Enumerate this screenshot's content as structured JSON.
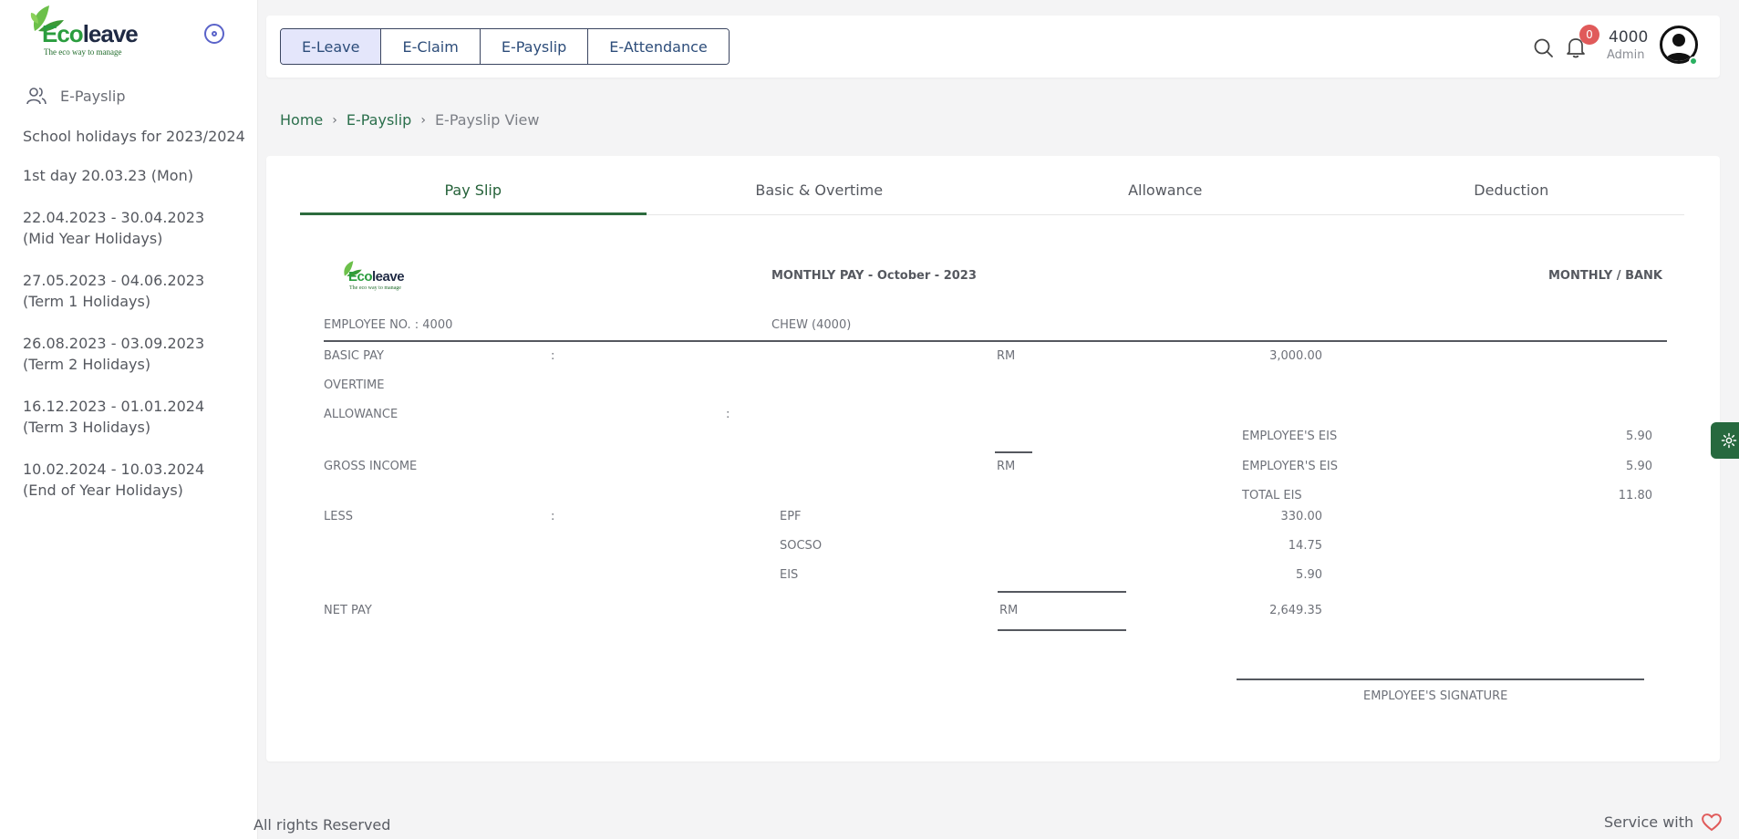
{
  "sidebar": {
    "logo_brand_prefix": "Eco",
    "logo_brand_suffix": "leave",
    "logo_tagline": "The eco way to manage",
    "menu_item": "E-Payslip",
    "holidays_title": "School holidays for 2023/2024",
    "holidays": [
      {
        "line1": "1st day 20.03.23 (Mon)",
        "line2": ""
      },
      {
        "line1": "22.04.2023 - 30.04.2023",
        "line2": "(Mid Year Holidays)"
      },
      {
        "line1": "27.05.2023 - 04.06.2023",
        "line2": "(Term 1 Holidays)"
      },
      {
        "line1": "26.08.2023 - 03.09.2023",
        "line2": "(Term 2 Holidays)"
      },
      {
        "line1": "16.12.2023 - 01.01.2024",
        "line2": "(Term 3 Holidays)"
      },
      {
        "line1": "10.02.2024 - 10.03.2024",
        "line2": "(End of Year Holidays)"
      }
    ]
  },
  "header": {
    "modules": [
      "E-Leave",
      "E-Claim",
      "E-Payslip",
      "E-Attendance"
    ],
    "active_module": "E-Leave",
    "notification_count": "0",
    "user_name": "4000",
    "user_role": "Admin",
    "icons": [
      "search-icon",
      "bell-icon",
      "user-avatar-icon"
    ]
  },
  "breadcrumb": {
    "home": "Home",
    "parent": "E-Payslip",
    "current": "E-Payslip View"
  },
  "tabs": [
    "Pay Slip",
    "Basic & Overtime",
    "Allowance",
    "Deduction"
  ],
  "active_tab": "Pay Slip",
  "payslip": {
    "title": "MONTHLY PAY - October - 2023",
    "pay_mode": "MONTHLY / BANK",
    "employee_no": "EMPLOYEE NO. : 4000",
    "employee_name": "CHEW (4000)",
    "basic_pay_label": "BASIC PAY",
    "colon": ":",
    "currency": "RM",
    "basic_pay_value": "3,000.00",
    "overtime_label": "OVERTIME",
    "allowance_label": "ALLOWANCE",
    "gross_income_label": "GROSS INCOME",
    "less_label": "LESS",
    "deductions": [
      {
        "label": "EPF",
        "value": "330.00"
      },
      {
        "label": "SOCSO",
        "value": "14.75"
      },
      {
        "label": "EIS",
        "value": "5.90"
      }
    ],
    "net_pay_label": "NET PAY",
    "net_pay_value": "2,649.35",
    "eis": [
      {
        "label": "EMPLOYEE'S EIS",
        "value": "5.90"
      },
      {
        "label": "EMPLOYER'S EIS",
        "value": "5.90"
      },
      {
        "label": "TOTAL EIS",
        "value": "11.80"
      }
    ],
    "signature_label": "EMPLOYEE'S SIGNATURE"
  },
  "footer": {
    "rights": "All rights Reserved",
    "service": "Service with"
  },
  "colors": {
    "primary_green": "#27693f",
    "active_module_bg": "#e4e6fb",
    "badge_red": "#e05a5a",
    "heart": "#e05a5a"
  }
}
